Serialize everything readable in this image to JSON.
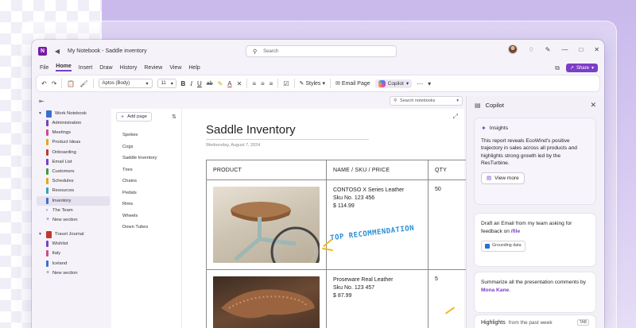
{
  "window": {
    "title": "My Notebook - Saddle inventory",
    "search_placeholder": "Search",
    "share_label": "Share"
  },
  "menu": [
    "File",
    "Home",
    "Insert",
    "Draw",
    "History",
    "Review",
    "View",
    "Help"
  ],
  "menu_active": "Home",
  "ribbon": {
    "font_name": "Aptos (Body)",
    "font_size": "11",
    "styles_label": "Styles",
    "email_page_label": "Email Page",
    "copilot_label": "Copilot"
  },
  "notebook_search_placeholder": "Search notebooks",
  "notebooks": [
    {
      "name": "Work Notebook",
      "color": "#3a6fd1",
      "sections": [
        {
          "label": "Administration",
          "color": "#7b3fc4"
        },
        {
          "label": "Meetings",
          "color": "#d14a8b"
        },
        {
          "label": "Product Ideas",
          "color": "#e0a91a"
        },
        {
          "label": "Onboarding",
          "color": "#c0392b"
        },
        {
          "label": "Email List",
          "color": "#7b3fc4"
        },
        {
          "label": "Customers",
          "color": "#3c9b43"
        },
        {
          "label": "Schedules",
          "color": "#e0a91a"
        },
        {
          "label": "Resources",
          "color": "#2fa7b4"
        },
        {
          "label": "Inventory",
          "color": "#3a6fd1"
        }
      ],
      "group": "The Team",
      "new_section": "New section"
    },
    {
      "name": "Travel Journal",
      "color": "#c0392b",
      "sections": [
        {
          "label": "Wishlist",
          "color": "#7b3fc4"
        },
        {
          "label": "Italy",
          "color": "#d14a8b"
        },
        {
          "label": "Iceland",
          "color": "#3a6fd1"
        }
      ],
      "new_section": "New section"
    }
  ],
  "selected_section": "Inventory",
  "pages": {
    "add_label": "Add page",
    "items": [
      "Spokes",
      "Cogs",
      "Saddle Inventory",
      "Tires",
      "Chains",
      "Pedals",
      "Rims",
      "Wheels",
      "Down Tubes"
    ]
  },
  "page": {
    "title": "Saddle Inventory",
    "date": "Wednesday, August 7, 2024",
    "headers": [
      "PRODUCT",
      "NAME  /  SKU  /  PRICE",
      "QTY"
    ],
    "rows": [
      {
        "name": "CONTOSO X Series Leather",
        "sku": "Sku No. 123 456",
        "price": "$ 114.99",
        "qty": "50"
      },
      {
        "name": "Proseware Real Leather",
        "sku": "Sku No. 123 457",
        "price": "$ 87.99",
        "qty": "5"
      }
    ],
    "annotation": "TOP RECOMMENDATION"
  },
  "copilot": {
    "title": "Copilot",
    "insights_title": "Insights",
    "insights_text": "This report reveals EcoWind's positive trajectory in sales across all products and highlights strong growth led by the ResTurbine.",
    "view_more": "View more",
    "draft_text": "Draft an Email from my team asking for feedback on ",
    "draft_link": "/file",
    "grounding": "Grounding data",
    "summarize_text": "Summarize all the presentation comments by ",
    "summarize_link": "Mona Kane",
    "summarize_end": ".",
    "highlights_title": "Highlights",
    "highlights_sub": "from the past week",
    "tab_key": "TAB"
  }
}
